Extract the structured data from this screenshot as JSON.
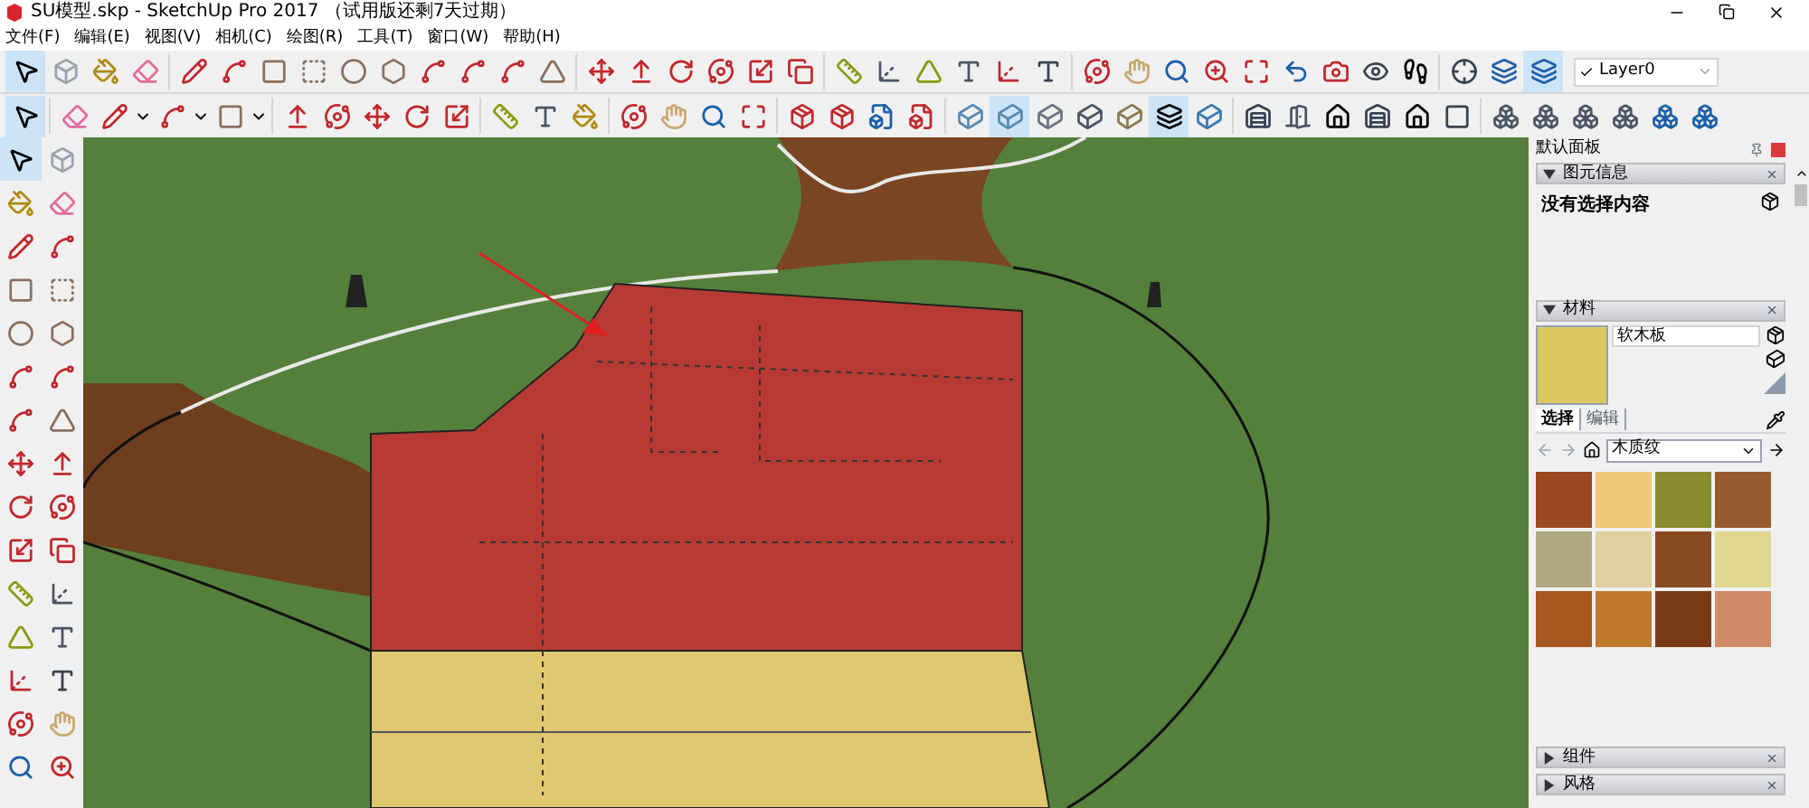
{
  "window": {
    "title": "SU模型.skp - SketchUp Pro 2017 （试用版还剩7天过期）"
  },
  "menu": [
    "文件(F)",
    "编辑(E)",
    "视图(V)",
    "相机(C)",
    "绘图(R)",
    "工具(T)",
    "窗口(W)",
    "帮助(H)"
  ],
  "layer_select": {
    "value": "Layer0"
  },
  "panel": {
    "title": "默认面板",
    "sections": [
      {
        "kind": "entity_info",
        "title": "图元信息",
        "expanded": true,
        "text": "没有选择内容"
      },
      {
        "kind": "materials",
        "title": "材料",
        "expanded": true,
        "material_name": "软木板",
        "tabs": [
          {
            "label": "选择",
            "selected": true
          },
          {
            "label": "编辑",
            "selected": false
          }
        ],
        "library": "木质纹",
        "swatches": [
          {
            "color": "#9a4a1e"
          },
          {
            "color": "#f0c878"
          },
          {
            "color": "#8a8a30"
          },
          {
            "color": "#9a5a30"
          },
          {
            "color": "#b0a880"
          },
          {
            "color": "#e0d0a0"
          },
          {
            "color": "#8a4a20"
          },
          {
            "color": "#e0d890"
          },
          {
            "color": "#a8581e"
          },
          {
            "color": "#c07a30"
          },
          {
            "color": "#7a3a18"
          },
          {
            "color": "#d08a6a"
          }
        ]
      },
      {
        "title": "组件",
        "expanded": false
      },
      {
        "title": "风格",
        "expanded": false
      }
    ]
  }
}
